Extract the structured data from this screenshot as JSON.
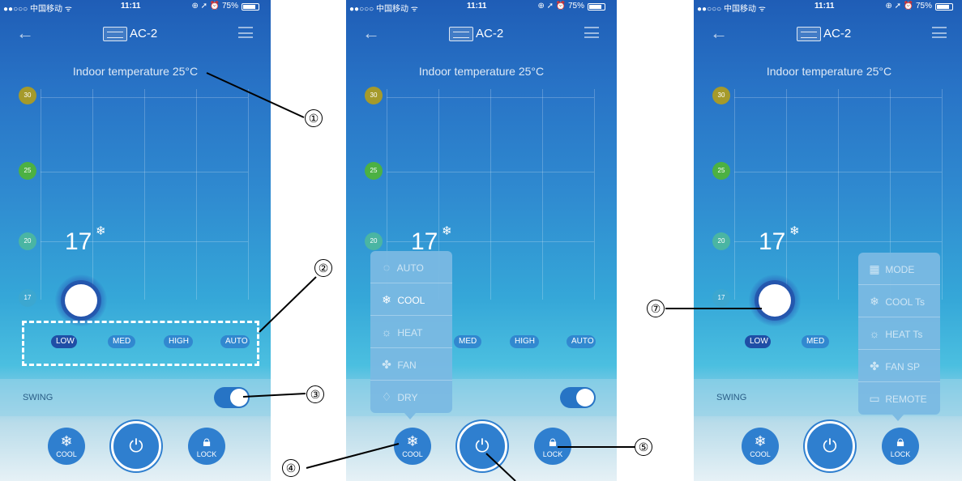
{
  "statusbar": {
    "carrier": "●●○○○ 中国移动 ᯤ",
    "time": "11:11",
    "battery": "⊕ ➚ ⏰ 75%"
  },
  "navbar": {
    "title": "AC-2",
    "back_icon": "arrow-left-icon",
    "menu_icon": "hamburger-icon"
  },
  "indoor_temperature": "Indoor temperature 25°C",
  "temperature_scale": [
    "30",
    "25",
    "20",
    "17"
  ],
  "set_temperature": "17",
  "mode_glyph": "❄",
  "fan_speeds": [
    "LOW",
    "MED",
    "HIGH",
    "AUTO"
  ],
  "selected_fan_speed": "LOW",
  "swing_label_1": "SWING",
  "swing_label_2": "SWING",
  "swing_on": true,
  "buttons": {
    "mode_label": "COOL",
    "lock_label": "LOCK",
    "power_icon": "power-icon"
  },
  "mode_menu": [
    {
      "icon": "◌",
      "label": "AUTO"
    },
    {
      "icon": "❄",
      "label": "COOL"
    },
    {
      "icon": "☼",
      "label": "HEAT"
    },
    {
      "icon": "✤",
      "label": "FAN"
    },
    {
      "icon": "♢",
      "label": "DRY"
    }
  ],
  "selected_mode": "COOL",
  "lock_menu": [
    {
      "icon": "▦",
      "label": "MODE"
    },
    {
      "icon": "❄",
      "label": "COOL Ts"
    },
    {
      "icon": "☼",
      "label": "HEAT Ts"
    },
    {
      "icon": "✤",
      "label": "FAN SP"
    },
    {
      "icon": "▭",
      "label": "REMOTE"
    }
  ],
  "callouts": [
    "①",
    "②",
    "③",
    "④",
    "⑤",
    "⑦"
  ],
  "colors": {
    "accent": "#2f7fcf",
    "top_blue": "#1f5db6",
    "dot_30": "#a59a2b",
    "dot_25": "#4cb143",
    "dot_20": "#4ab5a3"
  }
}
